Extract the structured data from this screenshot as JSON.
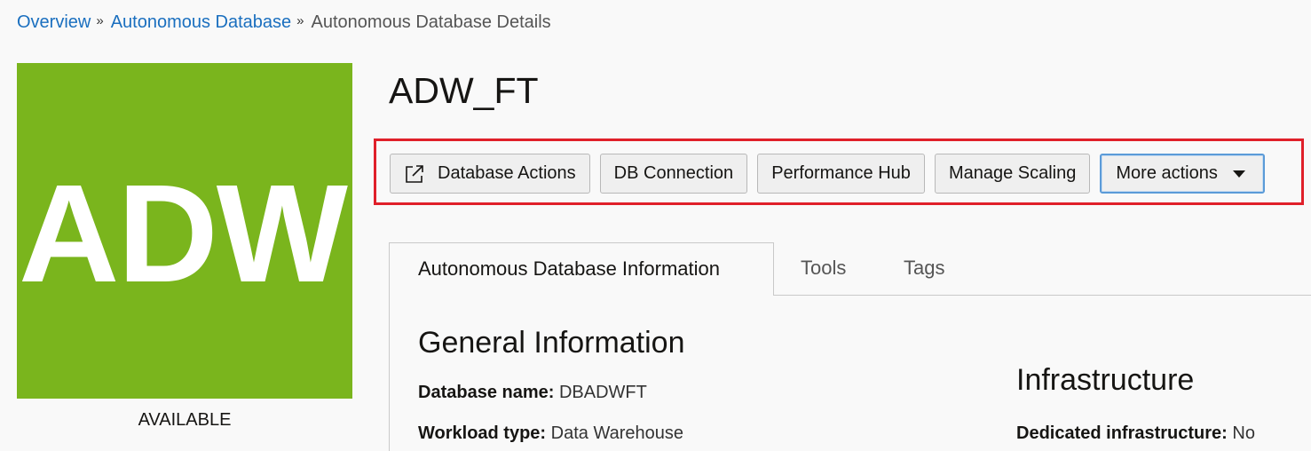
{
  "breadcrumb": {
    "items": [
      "Overview",
      "Autonomous Database"
    ],
    "separator": "»",
    "current": "Autonomous Database Details"
  },
  "tile": {
    "text": "ADW",
    "color": "#7ab51d",
    "status": "AVAILABLE"
  },
  "title": "ADW_FT",
  "toolbar": {
    "buttons": [
      {
        "label": "Database Actions",
        "icon": "external-link-icon"
      },
      {
        "label": "DB Connection"
      },
      {
        "label": "Performance Hub"
      },
      {
        "label": "Manage Scaling"
      },
      {
        "label": "More actions",
        "icon": "caret-down-icon"
      }
    ],
    "highlight_color": "#e0202a"
  },
  "tabs": [
    {
      "label": "Autonomous Database Information",
      "active": true
    },
    {
      "label": "Tools"
    },
    {
      "label": "Tags"
    }
  ],
  "general": {
    "title": "General Information",
    "fields": [
      {
        "label": "Database name:",
        "value": "DBADWFT"
      },
      {
        "label": "Workload type:",
        "value": "Data Warehouse"
      }
    ]
  },
  "infrastructure": {
    "title": "Infrastructure",
    "fields": [
      {
        "label": "Dedicated infrastructure:",
        "value": "No"
      }
    ]
  }
}
